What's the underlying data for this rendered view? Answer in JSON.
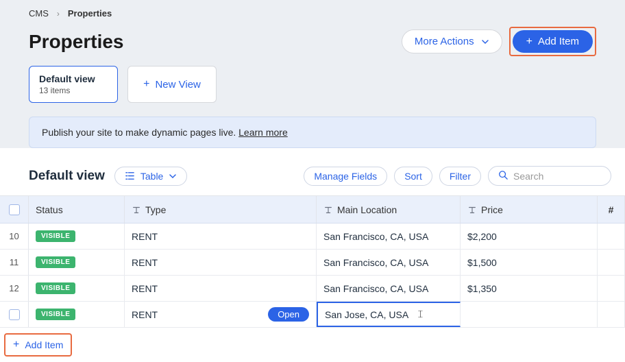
{
  "breadcrumb": {
    "root": "CMS",
    "current": "Properties"
  },
  "page": {
    "title": "Properties"
  },
  "actions": {
    "more": "More Actions",
    "add": "Add Item"
  },
  "views": {
    "default": {
      "name": "Default view",
      "count": "13 items"
    },
    "new": "New View"
  },
  "notice": {
    "text": "Publish your site to make dynamic pages live. ",
    "link": "Learn more"
  },
  "toolbar": {
    "title": "Default view",
    "display": "Table",
    "manage": "Manage Fields",
    "sort": "Sort",
    "filter": "Filter",
    "searchPlaceholder": "Search"
  },
  "columns": {
    "status": "Status",
    "type": "Type",
    "loc": "Main Location",
    "price": "Price",
    "last": "#"
  },
  "rows": [
    {
      "num": "10",
      "status": "VISIBLE",
      "type": "RENT",
      "loc": "San Francisco, CA, USA",
      "price": "$2,200"
    },
    {
      "num": "11",
      "status": "VISIBLE",
      "type": "RENT",
      "loc": "San Francisco, CA, USA",
      "price": "$1,500"
    },
    {
      "num": "12",
      "status": "VISIBLE",
      "type": "RENT",
      "loc": "San Francisco, CA, USA",
      "price": "$1,350"
    }
  ],
  "editingRow": {
    "status": "VISIBLE",
    "type": "RENT",
    "open": "Open",
    "loc": "San Jose, CA, USA",
    "price": ""
  },
  "footer": {
    "add": "Add Item"
  }
}
